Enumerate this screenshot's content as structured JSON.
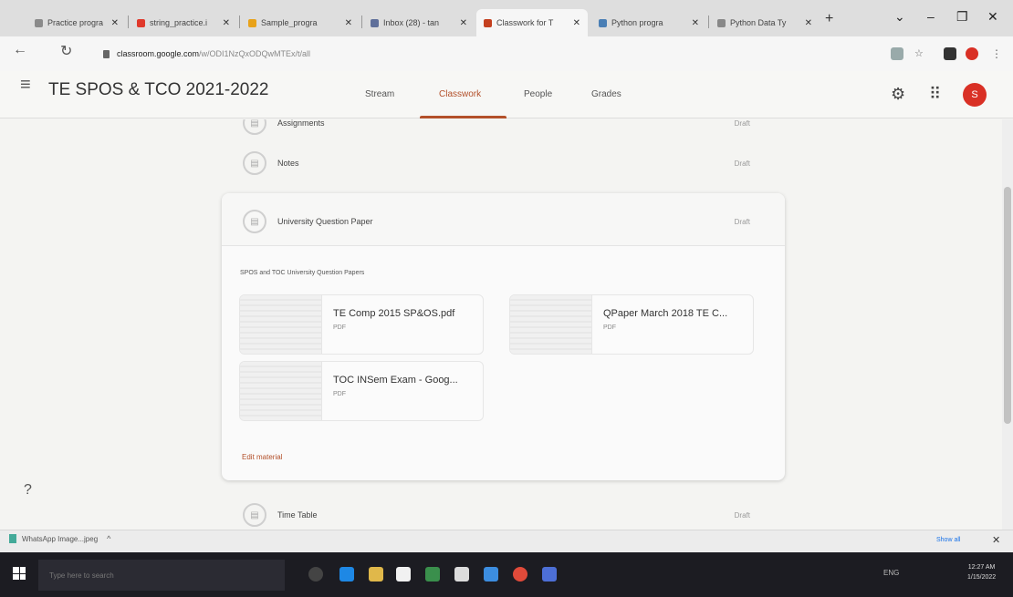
{
  "browser": {
    "tabs": [
      {
        "title": "Practice progra",
        "color": "#8a8a8a"
      },
      {
        "title": "string_practice.i",
        "color": "#e0392b"
      },
      {
        "title": "Sample_progra",
        "color": "#e8a21a"
      },
      {
        "title": "Inbox (28) - tan",
        "color": "#5f6f9a"
      },
      {
        "title": "Classwork for T",
        "color": "#c4401f"
      },
      {
        "title": "Python progra",
        "color": "#4a7fb5"
      },
      {
        "title": "Python Data Ty",
        "color": "#888888"
      }
    ],
    "active_tab_index": 4,
    "new_tab": "+",
    "url_domain": "classroom.google.com",
    "url_path": "/w/ODI1NzQxODQwMTEx/t/all"
  },
  "app": {
    "class_title": "TE SPOS & TCO 2021-2022",
    "nav_tabs": [
      "Stream",
      "Classwork",
      "People",
      "Grades"
    ],
    "active_nav": "Classwork",
    "avatar_letter": "S",
    "accent_color": "#b3502a"
  },
  "topics": [
    {
      "title": "Assignments",
      "date": "Draft"
    },
    {
      "title": "Notes",
      "date": "Draft"
    },
    {
      "title": "University Question Paper",
      "date": "Draft"
    },
    {
      "title": "Time Table",
      "date": "Draft"
    }
  ],
  "expanded": {
    "description": "SPOS and TOC University Question Papers",
    "attachments": [
      {
        "name": "TE Comp 2015 SP&OS.pdf",
        "type": "PDF"
      },
      {
        "name": "QPaper March 2018 TE C...",
        "type": "PDF"
      },
      {
        "name": "TOC INSem Exam - Goog...",
        "type": "PDF"
      }
    ],
    "edit_label": "Edit material"
  },
  "downloads": {
    "file": "WhatsApp Image...jpeg",
    "chevron": "^",
    "show_all": "Show all"
  },
  "taskbar": {
    "search_placeholder": "Type here to search",
    "clock_time": "12:27 AM",
    "clock_date": "1/15/2022",
    "tray_text": "ENG"
  }
}
